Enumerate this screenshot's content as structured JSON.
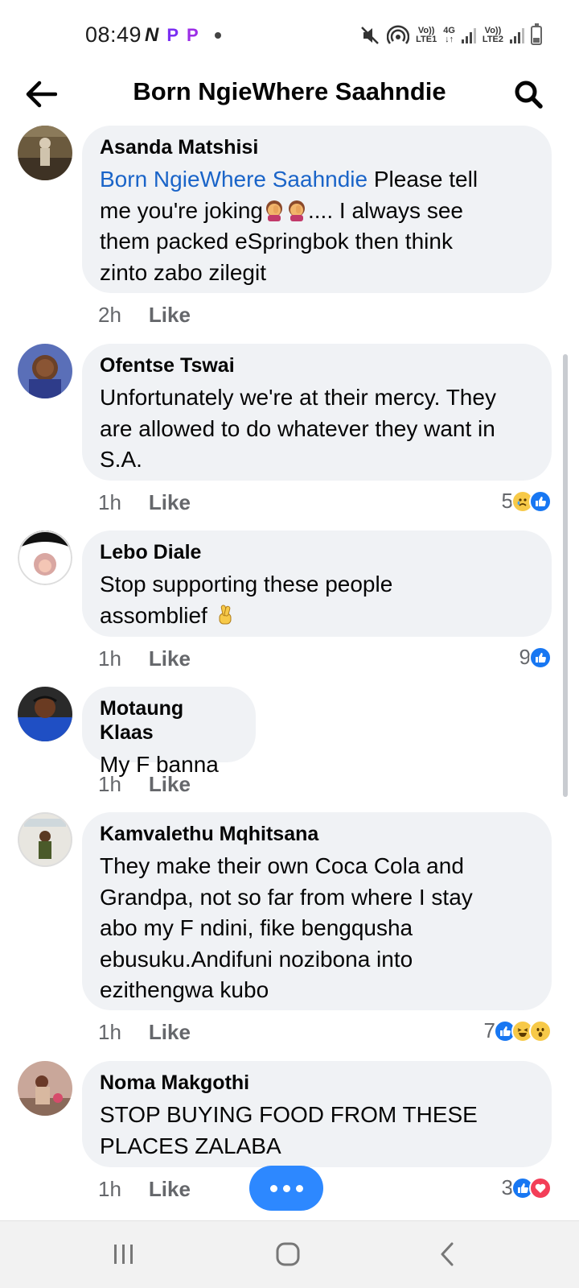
{
  "status_bar": {
    "time": "08:49",
    "left_icons": [
      "N",
      "P",
      "P"
    ],
    "sim1_label": "Vo))",
    "sim1_sub": "LTE1",
    "sim2_label": "Vo))",
    "sim2_sub": "LTE2",
    "network": "4G"
  },
  "header": {
    "title": "Born NgieWhere Saahndie"
  },
  "comments": [
    {
      "author": "Asanda Matshisi",
      "mention": "Born NgieWhere Saahndie",
      "text_lines": [
        " Please tell",
        "me you're joking",
        ".... I always see",
        "them packed eSpringbok then think",
        "zinto zabo zilegit"
      ],
      "time": "2h",
      "like_label": "Like"
    },
    {
      "author": "Ofentse Tswai",
      "text_lines": [
        "Unfortunately we're at their mercy. They",
        "are allowed to do whatever they want in",
        "S.A."
      ],
      "time": "1h",
      "like_label": "Like",
      "reaction_count": "5"
    },
    {
      "author": "Lebo Diale",
      "text_lines": [
        "Stop supporting these people",
        "assomblief"
      ],
      "time": "1h",
      "like_label": "Like",
      "reaction_count": "9"
    },
    {
      "author": "Motaung Klaas",
      "text_lines": [
        "My F banna"
      ],
      "time": "1h",
      "like_label": "Like"
    },
    {
      "author": "Kamvalethu Mqhitsana",
      "text_lines": [
        "They make their own Coca Cola and",
        "Grandpa, not so far from where I stay",
        "abo my F ndini, fike bengqusha",
        "ebusuku.Andifuni nozibona into",
        "ezithengwa kubo"
      ],
      "time": "1h",
      "like_label": "Like",
      "reaction_count": "7"
    },
    {
      "author": "Noma Makgothi",
      "text_lines": [
        "STOP BUYING FOOD FROM THESE",
        "PLACES ZALABA"
      ],
      "time": "1h",
      "like_label": "Like",
      "reaction_count": "3"
    }
  ],
  "colors": {
    "mention": "#1a64c8",
    "bubble": "#f0f2f5",
    "accent": "#2d88ff"
  }
}
